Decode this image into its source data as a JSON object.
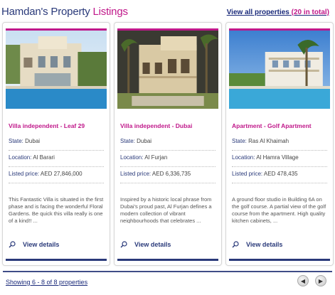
{
  "header": {
    "title_part1": "Hamdan's Property",
    "title_part2": "Listings",
    "view_all_label": "View all properties",
    "view_all_count": "(20 in total)"
  },
  "colors": {
    "brand_blue": "#2a3a7a",
    "accent_magenta": "#c0188a"
  },
  "labels": {
    "state": "State:",
    "location": "Location:",
    "price": "Listed price:",
    "view_details": "View details"
  },
  "listings": [
    {
      "title": "Villa independent - Leaf 29",
      "state": "Dubai",
      "location": "Al Barari",
      "price": "AED 27,846,000",
      "description": "This Fantastic Villa is situated in the first phase and is facing the wonderful Floral Gardens. Be quick this villa really is one of a kind!! ...",
      "photo": "villa-with-pool"
    },
    {
      "title": "Villa independent - Dubai",
      "state": "Dubai",
      "location": "Al Furjan",
      "price": "AED 6,336,735",
      "description": "Inspired by a historic local phrase from Dubai's proud past, Al Furjan defines a modern collection of vibrant neighbourhoods that celebrates ...",
      "photo": "villa-with-palms"
    },
    {
      "title": "Apartment - Golf Apartment",
      "state": "Ras Al Khaimah",
      "location": "Al Hamra Village",
      "price": "AED 478,435",
      "description": "A ground floor studio in Building 6A on the golf course. A partial view of the golf course from the apartment. High quality kitchen cabinets, ...",
      "photo": "apartment-with-pool"
    }
  ],
  "footer": {
    "showing": "Showing 6 - 8 of 8 properties",
    "prev_icon": "chevron-left-icon",
    "next_icon": "chevron-right-icon"
  }
}
